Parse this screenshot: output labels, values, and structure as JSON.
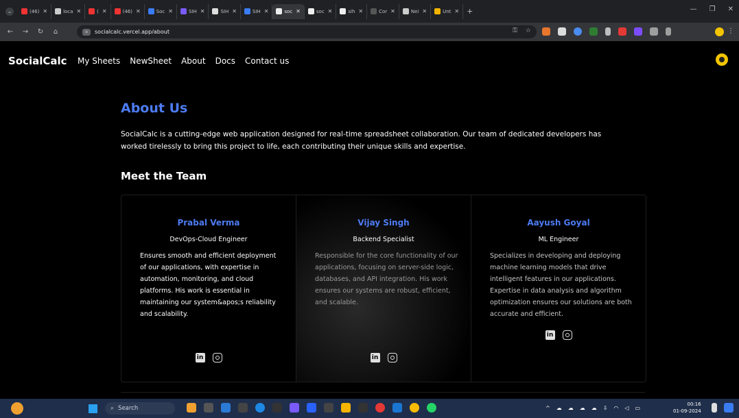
{
  "browser": {
    "tabs": [
      {
        "label": "(46)",
        "color": "#e33"
      },
      {
        "label": "loca",
        "color": "#ccc"
      },
      {
        "label": "(",
        "color": "#e33"
      },
      {
        "label": "(46)",
        "color": "#e33"
      },
      {
        "label": "Soc",
        "color": "#3a7cf2"
      },
      {
        "label": "SIH",
        "color": "#7a5af8"
      },
      {
        "label": "SIH",
        "color": "#ddd"
      },
      {
        "label": "SIH",
        "color": "#3a7cf2"
      },
      {
        "label": "soc",
        "color": "#eee",
        "active": true
      },
      {
        "label": "soc",
        "color": "#eee"
      },
      {
        "label": "sih",
        "color": "#eee"
      },
      {
        "label": "Cor",
        "color": "#555"
      },
      {
        "label": "Nei",
        "color": "#ccc"
      },
      {
        "label": "Unt",
        "color": "#f2b400"
      }
    ],
    "new_tab": "+",
    "url": "socialcalc.vercel.app/about"
  },
  "app": {
    "brand": "SocialCalc",
    "nav": [
      "My Sheets",
      "NewSheet",
      "About",
      "Docs",
      "Contact us"
    ]
  },
  "about": {
    "title": "About Us",
    "text": "SocialCalc is a cutting-edge web application designed for real-time spreadsheet collaboration. Our team of dedicated developers has worked tirelessly to bring this project to life, each contributing their unique skills and expertise."
  },
  "team": {
    "title": "Meet the Team",
    "members": [
      {
        "name": "Prabal Verma",
        "role": "DevOps-Cloud Engineer",
        "desc": "Ensures smooth and efficient deployment of our applications, with expertise in automation, monitoring, and cloud platforms. His work is essential in maintaining our system&apos;s reliability and scalability."
      },
      {
        "name": "Vijay Singh",
        "role": "Backend Specialist",
        "desc": "Responsible for the core functionality of our applications, focusing on server-side logic, databases, and API integration. His work ensures our systems are robust, efficient, and scalable."
      },
      {
        "name": "Aayush Goyal",
        "role": "ML Engineer",
        "desc": "Specializes in developing and deploying machine learning models that drive intelligent features in our applications. Expertise in data analysis and algorithm optimization ensures our solutions are both accurate and efficient."
      }
    ]
  },
  "taskbar": {
    "search_label": "Search",
    "time": "00:16",
    "date": "01-09-2024"
  }
}
